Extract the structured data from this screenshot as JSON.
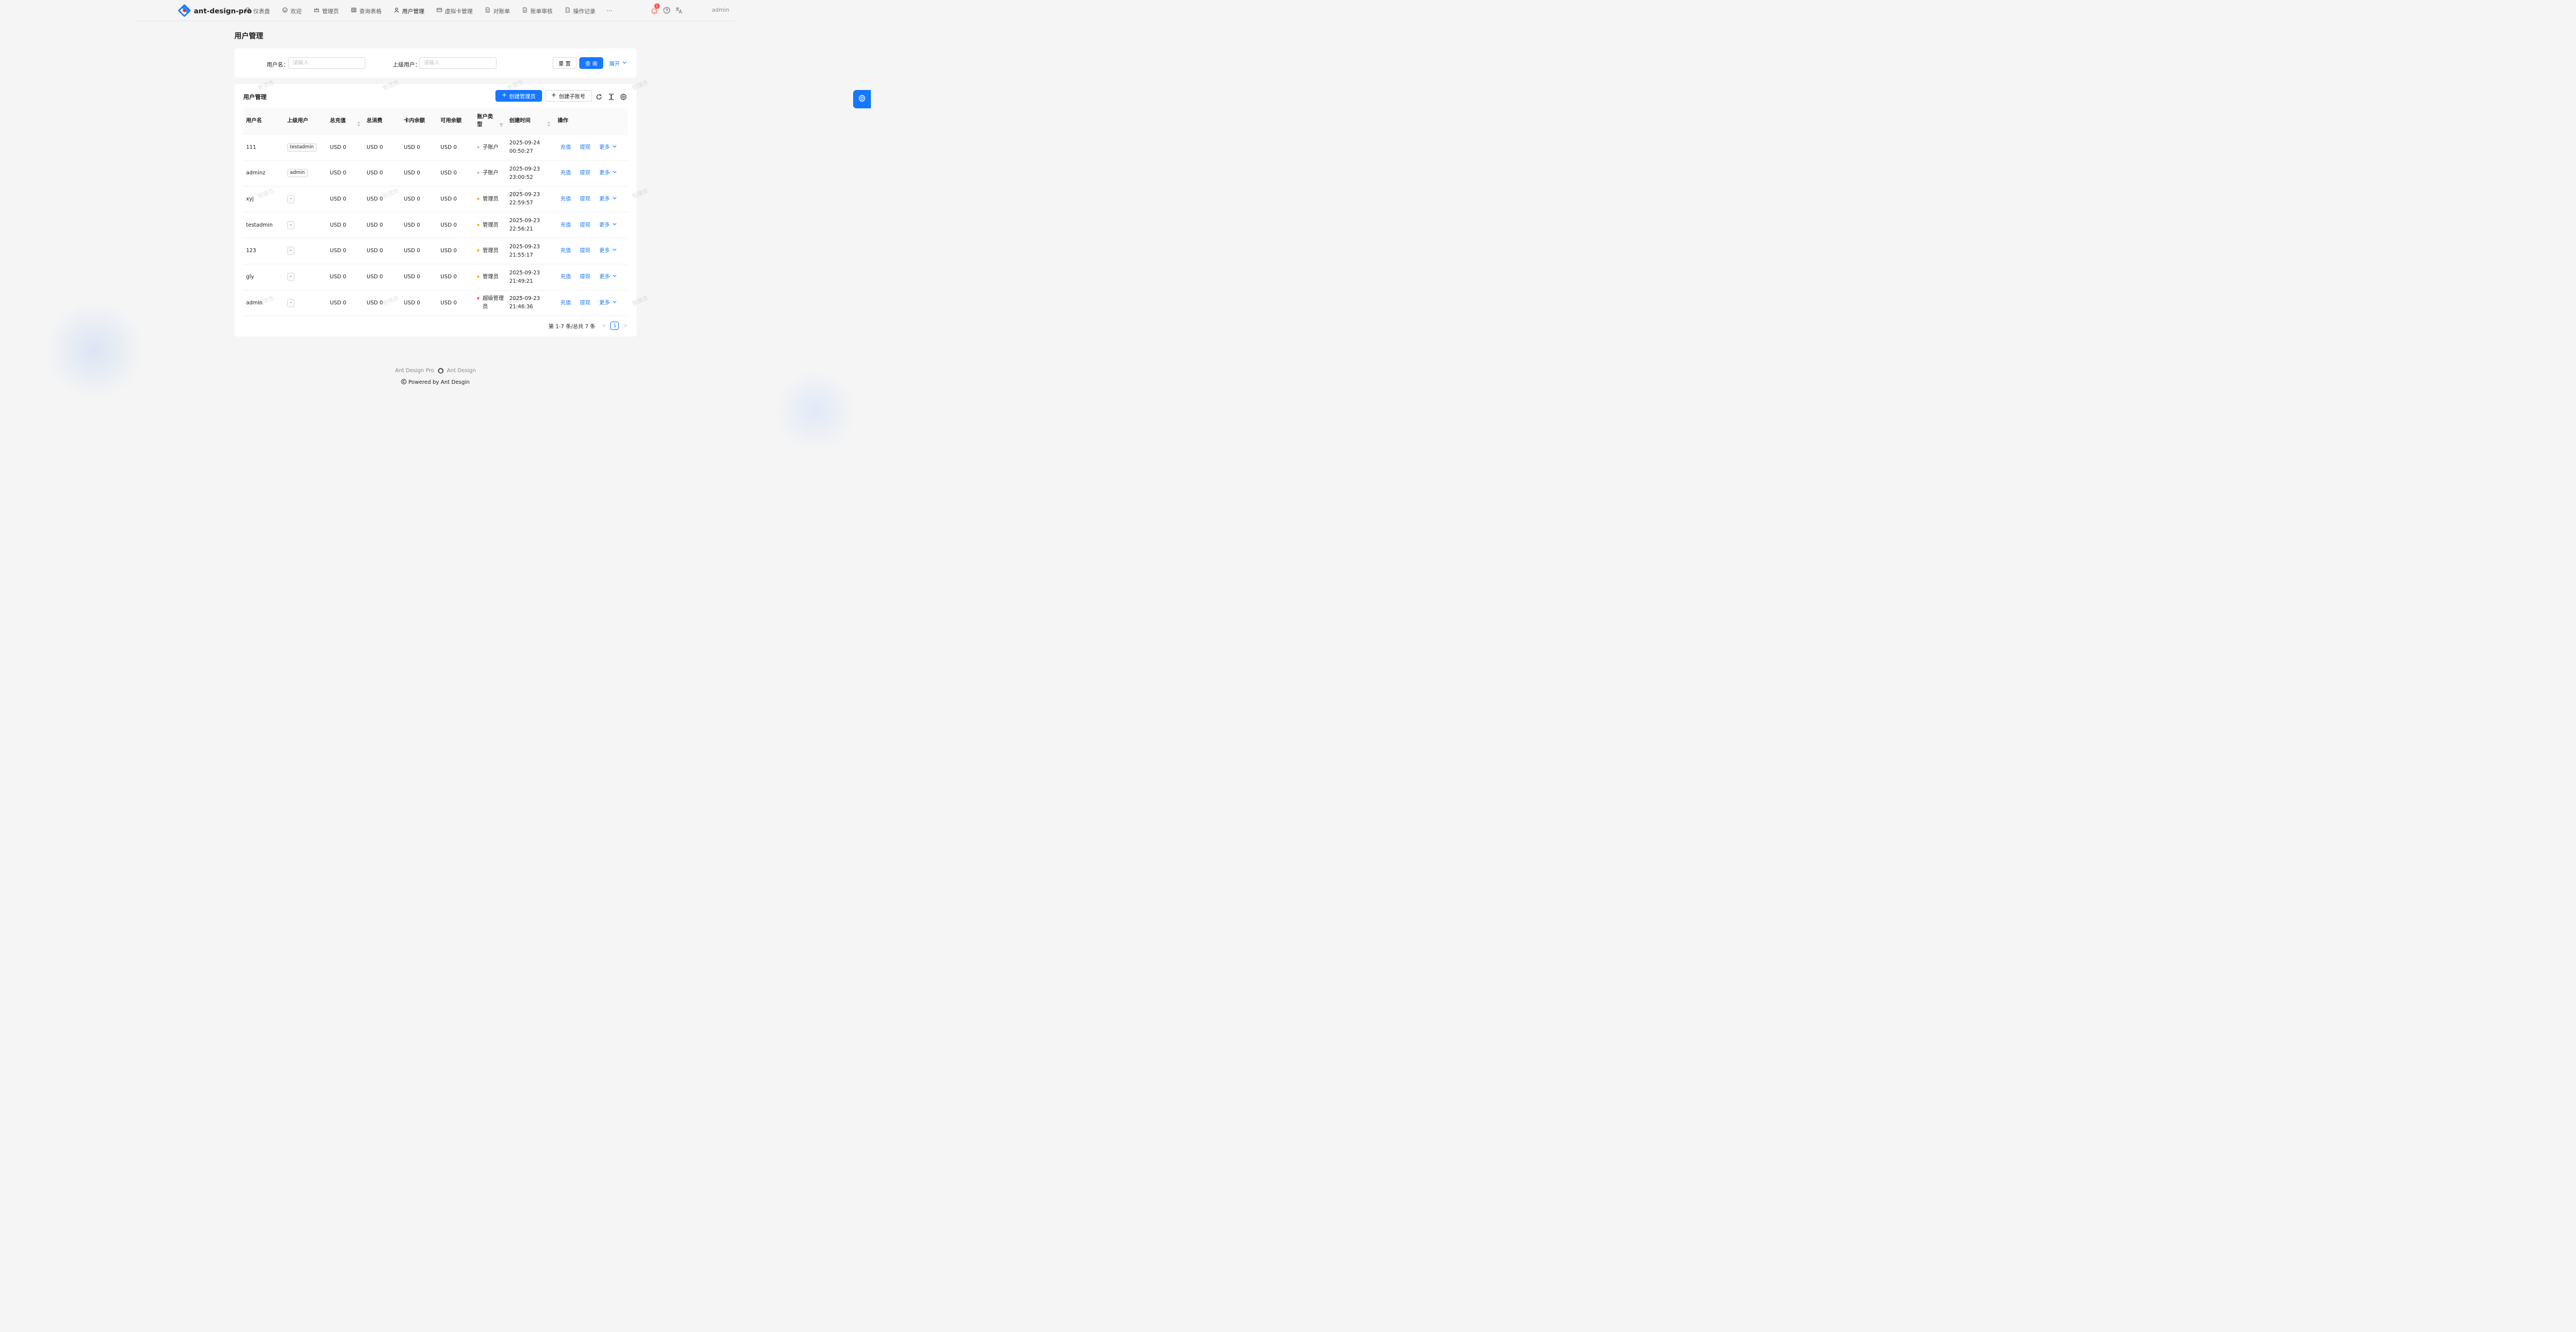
{
  "app": {
    "name": "ant-design-pro"
  },
  "nav": {
    "items": [
      {
        "label": "仪表盘",
        "icon": "dashboard-icon"
      },
      {
        "label": "欢迎",
        "icon": "smile-icon"
      },
      {
        "label": "管理页",
        "icon": "crown-icon"
      },
      {
        "label": "查询表格",
        "icon": "table-icon"
      },
      {
        "label": "用户管理",
        "icon": "user-icon",
        "active": true
      },
      {
        "label": "虚拟卡管理",
        "icon": "credit-card-icon"
      },
      {
        "label": "对账单",
        "icon": "file-text-icon"
      },
      {
        "label": "账单审核",
        "icon": "file-check-icon"
      },
      {
        "label": "操作记录",
        "icon": "file-icon"
      }
    ],
    "more": "···",
    "notification_count": "1",
    "username": "admin"
  },
  "page": {
    "title": "用户管理"
  },
  "search": {
    "username_label": "用户名：",
    "username_placeholder": "请输入",
    "parent_label": "上级用户：",
    "parent_placeholder": "请输入",
    "reset": "重 置",
    "query": "查 询",
    "expand": "展开"
  },
  "table": {
    "title": "用户管理",
    "create_admin": "创建管理员",
    "create_sub": "创建子账号",
    "columns": [
      "用户名",
      "上级用户",
      "总充值",
      "总消费",
      "卡内余额",
      "可用余额",
      "账户类型",
      "创建时间",
      "操作"
    ],
    "rows": [
      {
        "username": "111",
        "parent": "testadmin",
        "recharge": "USD 0",
        "consume": "USD 0",
        "card_balance": "USD 0",
        "available": "USD 0",
        "type": "子账户",
        "type_color": "#bfbfbf",
        "date": "2025-09-24",
        "time": "00:50:27"
      },
      {
        "username": "adminz",
        "parent": "admin",
        "recharge": "USD 0",
        "consume": "USD 0",
        "card_balance": "USD 0",
        "available": "USD 0",
        "type": "子账户",
        "type_color": "#bfbfbf",
        "date": "2025-09-23",
        "time": "23:00:52"
      },
      {
        "username": "xyj",
        "parent": "-",
        "recharge": "USD 0",
        "consume": "USD 0",
        "card_balance": "USD 0",
        "available": "USD 0",
        "type": "管理员",
        "type_color": "#faad14",
        "date": "2025-09-23",
        "time": "22:59:57"
      },
      {
        "username": "testadmin",
        "parent": "-",
        "recharge": "USD 0",
        "consume": "USD 0",
        "card_balance": "USD 0",
        "available": "USD 0",
        "type": "管理员",
        "type_color": "#faad14",
        "date": "2025-09-23",
        "time": "22:56:21"
      },
      {
        "username": "123",
        "parent": "-",
        "recharge": "USD 0",
        "consume": "USD 0",
        "card_balance": "USD 0",
        "available": "USD 0",
        "type": "管理员",
        "type_color": "#faad14",
        "date": "2025-09-23",
        "time": "21:55:17"
      },
      {
        "username": "gly",
        "parent": "-",
        "recharge": "USD 0",
        "consume": "USD 0",
        "card_balance": "USD 0",
        "available": "USD 0",
        "type": "管理员",
        "type_color": "#faad14",
        "date": "2025-09-23",
        "time": "21:49:21"
      },
      {
        "username": "admin",
        "parent": "-",
        "recharge": "USD 0",
        "consume": "USD 0",
        "card_balance": "USD 0",
        "available": "USD 0",
        "type": "超级管理员",
        "type_color": "#ff4d4f",
        "date": "2025-09-23",
        "time": "21:46:36"
      }
    ],
    "actions": {
      "recharge": "充值",
      "withdraw": "提现",
      "more": "更多"
    },
    "pagination": {
      "summary": "第 1-7 条/总共 7 条",
      "current": "1"
    }
  },
  "watermark": "管理员",
  "footer": {
    "link1": "Ant Design Pro",
    "link2": "Ant Design",
    "copyright": "Powered by Ant Desgin"
  },
  "colors": {
    "primary": "#1677ff",
    "danger": "#ff4d4f",
    "warning": "#faad14"
  }
}
